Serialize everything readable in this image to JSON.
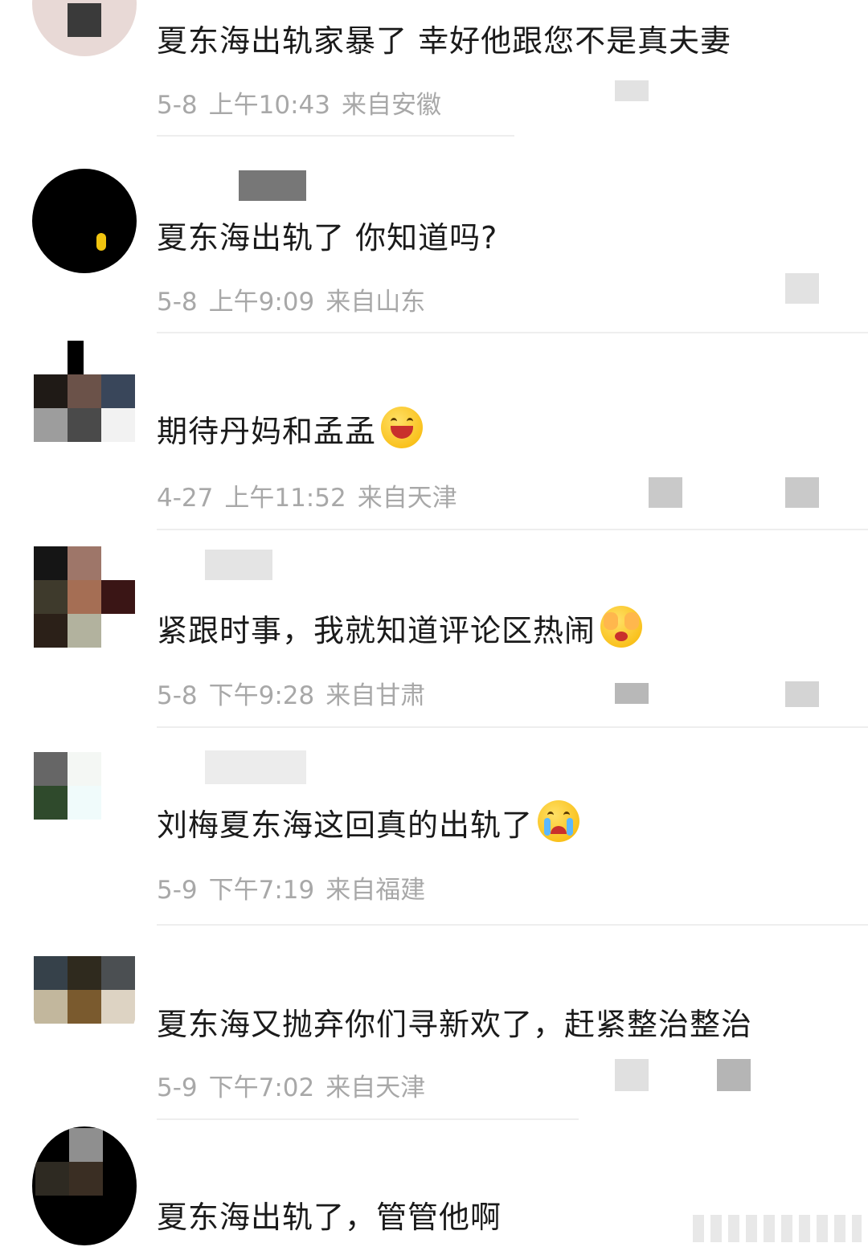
{
  "comments": [
    {
      "text": "夏东海出轨家暴了 幸好他跟您不是真夫妻",
      "date": "5-8",
      "time": "上午10:43",
      "location": "来自安徽",
      "emoji": ""
    },
    {
      "text": "夏东海出轨了 你知道吗?",
      "date": "5-8",
      "time": "上午9:09",
      "location": "来自山东",
      "emoji": ""
    },
    {
      "text": "期待丹妈和孟孟",
      "date": "4-27",
      "time": "上午11:52",
      "location": "来自天津",
      "emoji": "grinning-face-emoji"
    },
    {
      "text": "紧跟时事，我就知道评论区热闹",
      "date": "5-8",
      "time": "下午9:28",
      "location": "来自甘肃",
      "emoji": "covering-eyes-emoji"
    },
    {
      "text": "刘梅夏东海这回真的出轨了",
      "date": "5-9",
      "time": "下午7:19",
      "location": "来自福建",
      "emoji": "crying-face-emoji"
    },
    {
      "text": "夏东海又抛弃你们寻新欢了，赶紧整治整治",
      "date": "5-9",
      "time": "下午7:02",
      "location": "来自天津",
      "emoji": ""
    },
    {
      "text": "夏东海出轨了，管管他啊",
      "date": "",
      "time": "",
      "location": "",
      "emoji": ""
    }
  ],
  "colors": {
    "text": "#1a1a1a",
    "meta": "#a8a8a8",
    "divider": "#eeeeee",
    "redaction": "#dcdcdc"
  }
}
